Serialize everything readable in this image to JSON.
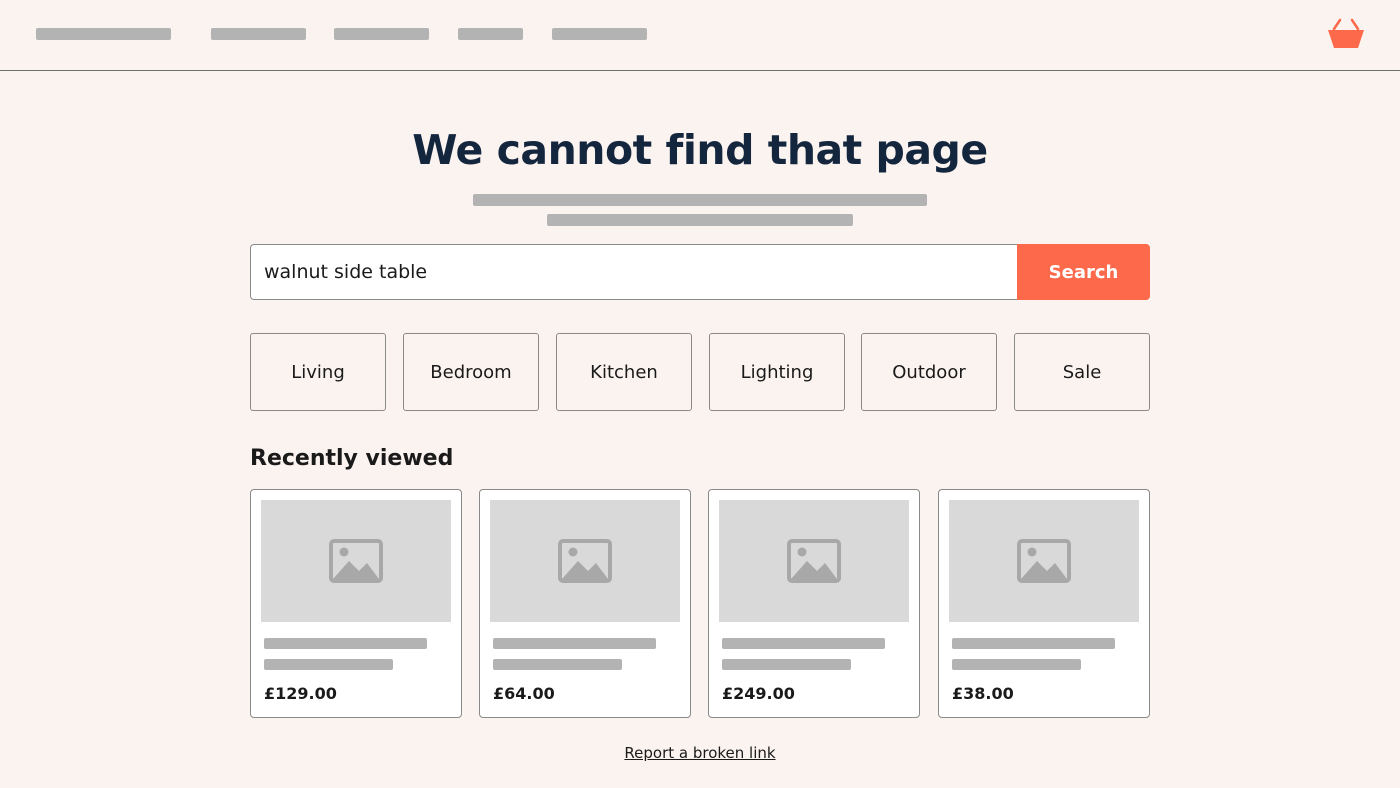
{
  "colors": {
    "background": "#fbf3f0",
    "accent": "#fd6a4b",
    "heading": "#14263e",
    "skeleton": "#b3b3b3",
    "image_placeholder": "#d9d9d9"
  },
  "header": {
    "nav_items": [
      "",
      "",
      "",
      "",
      ""
    ],
    "cart_icon": "basket-icon"
  },
  "main": {
    "title": "We cannot find that page",
    "search": {
      "value": "walnut side table",
      "button_label": "Search"
    },
    "categories": [
      "Living",
      "Bedroom",
      "Kitchen",
      "Lighting",
      "Outdoor",
      "Sale"
    ],
    "recently_viewed": {
      "title": "Recently viewed",
      "items": [
        {
          "price": "£129.00",
          "icon": "image-placeholder-icon"
        },
        {
          "price": "£64.00",
          "icon": "image-placeholder-icon"
        },
        {
          "price": "£249.00",
          "icon": "image-placeholder-icon"
        },
        {
          "price": "£38.00",
          "icon": "image-placeholder-icon"
        }
      ]
    },
    "report_link": "Report a broken link"
  }
}
